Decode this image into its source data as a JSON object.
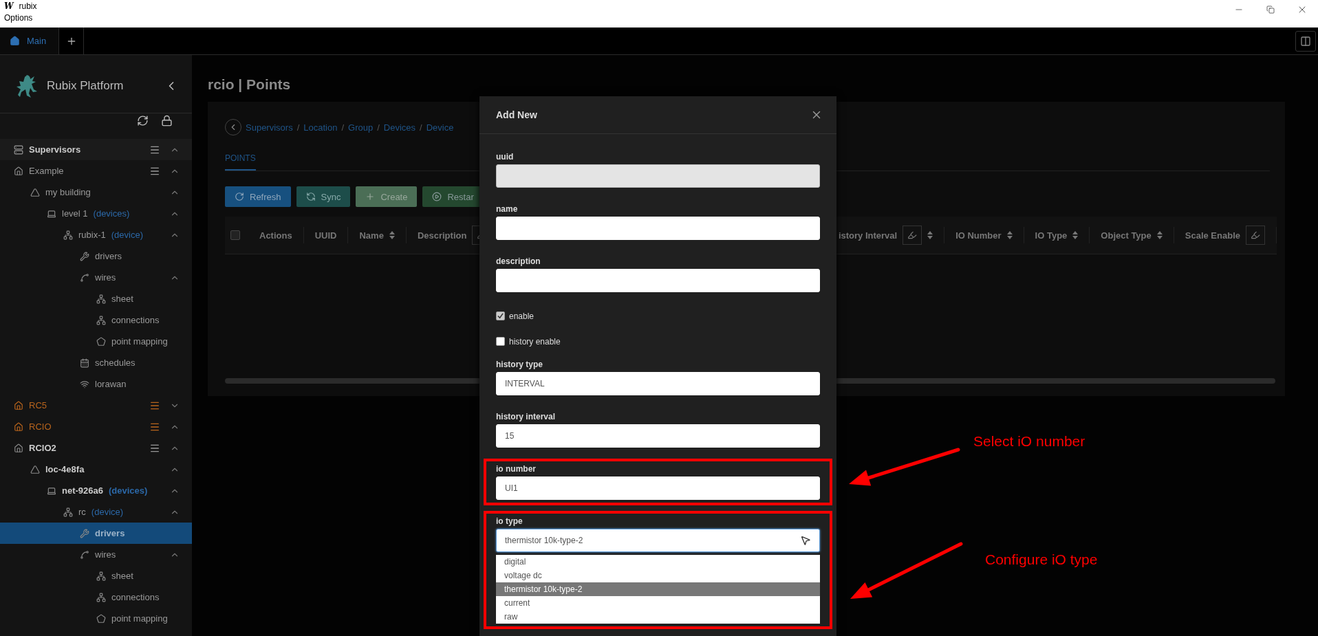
{
  "window": {
    "logo": "W",
    "title": "rubix",
    "menu": [
      "Options"
    ]
  },
  "tabs": [
    {
      "label": "Main",
      "selected": true
    }
  ],
  "sidebar": {
    "title": "Rubix Platform",
    "supervisors": {
      "label": "Supervisors",
      "expanded": true
    },
    "sites": [
      {
        "label": "Example",
        "kind": "site",
        "expanded": true,
        "warning": false,
        "bold": false,
        "selected": false,
        "children": [
          {
            "label": "my building",
            "kind": "location",
            "expanded": true,
            "bold": false,
            "selected": false,
            "children": [
              {
                "label": "level 1",
                "note": "(devices)",
                "kind": "network",
                "expanded": true,
                "bold": false,
                "selected": false,
                "children": [
                  {
                    "label": "rubix-1",
                    "note": "(device)",
                    "kind": "device",
                    "expanded": true,
                    "bold": false,
                    "selected": false,
                    "children": [
                      {
                        "label": "drivers",
                        "kind": "drivers",
                        "bold": false,
                        "selected": false
                      },
                      {
                        "label": "wires",
                        "kind": "wires",
                        "expanded": true,
                        "bold": false,
                        "selected": false,
                        "children": [
                          {
                            "label": "sheet",
                            "kind": "sheet",
                            "bold": false,
                            "selected": false
                          },
                          {
                            "label": "connections",
                            "kind": "sheet",
                            "bold": false,
                            "selected": false
                          },
                          {
                            "label": "point mapping",
                            "kind": "mapping",
                            "bold": false,
                            "selected": false
                          }
                        ]
                      },
                      {
                        "label": "schedules",
                        "kind": "schedules",
                        "bold": false,
                        "selected": false
                      },
                      {
                        "label": "lorawan",
                        "kind": "lorawan",
                        "bold": false,
                        "selected": false
                      }
                    ]
                  }
                ]
              }
            ]
          }
        ]
      },
      {
        "label": "RC5",
        "kind": "site",
        "expanded": false,
        "warning": true,
        "bold": false,
        "selected": false
      },
      {
        "label": "RCIO",
        "kind": "site",
        "expanded": true,
        "warning": true,
        "bold": false,
        "selected": false
      },
      {
        "label": "RCIO2",
        "kind": "site",
        "expanded": true,
        "warning": false,
        "bold": true,
        "selected": false,
        "children": [
          {
            "label": "loc-4e8fa",
            "kind": "location",
            "expanded": true,
            "bold": true,
            "selected": false,
            "children": [
              {
                "label": "net-926a6",
                "note": "(devices)",
                "kind": "network",
                "expanded": true,
                "bold": true,
                "selected": false,
                "children": [
                  {
                    "label": "rc",
                    "note": "(device)",
                    "kind": "device",
                    "expanded": true,
                    "bold": false,
                    "selected": false,
                    "children": [
                      {
                        "label": "drivers",
                        "kind": "drivers",
                        "bold": true,
                        "selected": true
                      },
                      {
                        "label": "wires",
                        "kind": "wires",
                        "expanded": true,
                        "bold": false,
                        "selected": false,
                        "children": [
                          {
                            "label": "sheet",
                            "kind": "sheet",
                            "bold": false,
                            "selected": false
                          },
                          {
                            "label": "connections",
                            "kind": "sheet",
                            "bold": false,
                            "selected": false
                          },
                          {
                            "label": "point mapping",
                            "kind": "mapping",
                            "bold": false,
                            "selected": false
                          }
                        ]
                      }
                    ]
                  }
                ]
              }
            ]
          }
        ]
      }
    ]
  },
  "page": {
    "title": "rcio | Points",
    "breadcrumb": [
      {
        "kind": "link",
        "label": "Supervisors"
      },
      {
        "kind": "separator",
        "label": "/"
      },
      {
        "kind": "link",
        "label": "Location"
      },
      {
        "kind": "separator",
        "label": "/"
      },
      {
        "kind": "link",
        "label": "Group"
      },
      {
        "kind": "separator",
        "label": "/"
      },
      {
        "kind": "link",
        "label": "Devices"
      },
      {
        "kind": "separator",
        "label": "/"
      },
      {
        "kind": "link",
        "label": "Device"
      }
    ],
    "tabs": [
      {
        "label": "POINTS",
        "selected": true
      }
    ],
    "buttons": [
      {
        "label": "Refresh",
        "kind": "refresh"
      },
      {
        "label": "Sync",
        "kind": "sync"
      },
      {
        "label": "Create",
        "kind": "create"
      },
      {
        "label": "Restar",
        "kind": "restart"
      }
    ],
    "table": {
      "select_all": {
        "checked": false
      },
      "left_columns": [
        {
          "label": "Actions"
        },
        {
          "label": "UUID"
        },
        {
          "label": "Name",
          "sort": true
        },
        {
          "label": "Description",
          "filter": true
        }
      ],
      "right_columns": [
        {
          "label": "istory Interval",
          "sort": true,
          "filter": true
        },
        {
          "label": "IO Number",
          "sort": true
        },
        {
          "label": "IO Type",
          "sort": true
        },
        {
          "label": "Object Type",
          "sort": true
        },
        {
          "label": "Scale Enable",
          "filter": true
        }
      ]
    }
  },
  "dialog": {
    "title": "Add New",
    "fields": [
      {
        "label": "uuid",
        "kind": "text",
        "disabled": true,
        "highlighted": false
      },
      {
        "label": "name",
        "kind": "text",
        "disabled": false,
        "highlighted": false
      },
      {
        "label": "description",
        "kind": "text",
        "disabled": false,
        "highlighted": false
      },
      {
        "label": "enable",
        "kind": "checkbox",
        "checked": true
      },
      {
        "label": "history enable",
        "kind": "checkbox",
        "checked": false
      },
      {
        "label": "history type",
        "kind": "text",
        "value": "INTERVAL",
        "disabled": false,
        "highlighted": false
      },
      {
        "label": "history interval",
        "kind": "text",
        "value": "15",
        "disabled": false,
        "highlighted": false
      },
      {
        "label": "io number",
        "kind": "text",
        "value": "UI1",
        "disabled": false,
        "highlighted": true
      },
      {
        "label": "io type",
        "kind": "select",
        "value": "thermistor 10k-type-2",
        "highlighted": true,
        "expanded": true,
        "options": [
          {
            "label": "digital",
            "selected": false
          },
          {
            "label": "voltage dc",
            "selected": false
          },
          {
            "label": "thermistor 10k-type-2",
            "selected": true
          },
          {
            "label": "current",
            "selected": false
          },
          {
            "label": "raw",
            "selected": false
          }
        ]
      }
    ]
  },
  "annotations": [
    {
      "text": "Select iO number"
    },
    {
      "text": "Configure iO type"
    }
  ]
}
